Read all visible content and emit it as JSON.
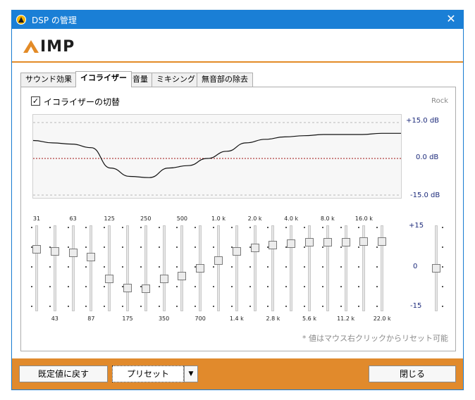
{
  "window": {
    "title": "DSP の管理",
    "close_label": "✕",
    "logo_text": "IMP"
  },
  "tabs": [
    {
      "label": "サウンド効果"
    },
    {
      "label": "イコライザー"
    },
    {
      "label": "音量"
    },
    {
      "label": "ミキシング"
    },
    {
      "label": "無音部の除去"
    }
  ],
  "equalizer": {
    "toggle_label": "イコライザーの切替",
    "toggle_checked": true,
    "check_glyph": "✓",
    "preset_name": "Rock",
    "graph_labels": {
      "top": "+15.0 dB",
      "mid": "0.0 dB",
      "bottom": "-15.0 dB"
    },
    "freq_top": [
      "31",
      "63",
      "125",
      "250",
      "500",
      "1.0 k",
      "2.0 k",
      "4.0 k",
      "8.0 k",
      "16.0 k"
    ],
    "freq_bottom": [
      "43",
      "87",
      "175",
      "350",
      "700",
      "1.4 k",
      "2.8 k",
      "5.6 k",
      "11.2 k",
      "22.0 k"
    ],
    "band_gains_db": [
      7.5,
      6.5,
      6,
      4.5,
      -4,
      -7.5,
      -8,
      -4,
      -3,
      0,
      3,
      6.5,
      8,
      9,
      9.5,
      10,
      10,
      10,
      10.5,
      10.5
    ],
    "preamp_db": 0,
    "scale": {
      "top": "+15",
      "mid": "0",
      "bottom": "-15"
    },
    "note": "* 値はマウス右クリックからリセット可能"
  },
  "footer": {
    "reset_label": "既定値に戻す",
    "preset_label": "プリセット",
    "dropdown_glyph": "▼",
    "close_label": "閉じる"
  },
  "colors": {
    "accent": "#e18a2c",
    "titlebar": "#1a7fd6",
    "curve": "#111111",
    "zero_line": "#a01010"
  }
}
